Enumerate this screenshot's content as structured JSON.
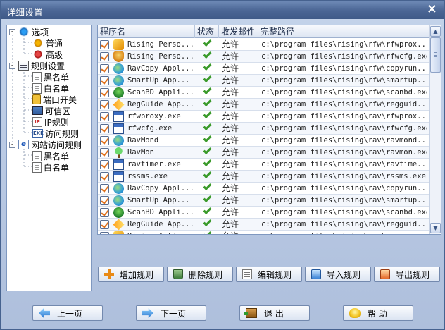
{
  "window": {
    "title": "详细设置"
  },
  "tree": [
    {
      "label": "选项",
      "icon": "gear-icon",
      "expander": "-"
    },
    {
      "label": "普通",
      "icon": "gear-small-icon"
    },
    {
      "label": "高级",
      "icon": "gear-red-icon"
    },
    {
      "label": "规则设置",
      "icon": "rules-icon",
      "expander": "-"
    },
    {
      "label": "黑名单",
      "icon": "document-icon"
    },
    {
      "label": "白名单",
      "icon": "document-icon"
    },
    {
      "label": "端口开关",
      "icon": "lock-icon"
    },
    {
      "label": "可信区",
      "icon": "computer-icon"
    },
    {
      "label": "IP规则",
      "icon": "ip-icon"
    },
    {
      "label": "访问规则",
      "icon": "exe-icon"
    },
    {
      "label": "网站访问规则",
      "icon": "web-icon",
      "expander": "-"
    },
    {
      "label": "黑名单",
      "icon": "document-icon"
    },
    {
      "label": "白名单",
      "icon": "document-icon"
    }
  ],
  "grid": {
    "columns": [
      "程序名",
      "状态",
      "收发邮件",
      "完整路径"
    ],
    "rows": [
      {
        "name": "Rising Perso...",
        "icon": "horse-icon",
        "mail": "允许",
        "path": "c:\\program files\\rising\\rfw\\rfwprox..."
      },
      {
        "name": "Rising Perso...",
        "icon": "shield-icon",
        "mail": "允许",
        "path": "c:\\program files\\rising\\rfw\\rfwcfg.exe"
      },
      {
        "name": "RavCopy Appl...",
        "icon": "globe-icon",
        "mail": "允许",
        "path": "c:\\program files\\rising\\rfw\\copyrun...."
      },
      {
        "name": "SmartUp  App...",
        "icon": "globe-icon",
        "mail": "允许",
        "path": "c:\\program files\\rising\\rfw\\smartup...."
      },
      {
        "name": "ScanBD Appli...",
        "icon": "green-shield-icon",
        "mail": "允许",
        "path": "c:\\program files\\rising\\rfw\\scanbd.exe"
      },
      {
        "name": "RegGuide App...",
        "icon": "diamond-icon",
        "mail": "允许",
        "path": "c:\\program files\\rising\\rfw\\regguid...."
      },
      {
        "name": "rfwproxy.exe",
        "icon": "window-icon",
        "mail": "允许",
        "path": "c:\\program files\\rising\\rav\\rfwprox..."
      },
      {
        "name": "rfwcfg.exe",
        "icon": "window-icon",
        "mail": "允许",
        "path": "c:\\program files\\rising\\rav\\rfwcfg.exe"
      },
      {
        "name": "RavMond",
        "icon": "globe-icon",
        "mail": "允许",
        "path": "c:\\program files\\rising\\rav\\ravmond...."
      },
      {
        "name": "RavMon",
        "icon": "tree-icon",
        "mail": "允许",
        "path": "c:\\program files\\rising\\rav\\ravmon.exe"
      },
      {
        "name": "ravtimer.exe",
        "icon": "window-icon",
        "mail": "允许",
        "path": "c:\\program files\\rising\\rav\\ravtime...."
      },
      {
        "name": "rssms.exe",
        "icon": "window-icon",
        "mail": "允许",
        "path": "c:\\program files\\rising\\rav\\rssms.exe"
      },
      {
        "name": "RavCopy Appl...",
        "icon": "globe-icon",
        "mail": "允许",
        "path": "c:\\program files\\rising\\rav\\copyrun...."
      },
      {
        "name": "SmartUp  App...",
        "icon": "globe-icon",
        "mail": "允许",
        "path": "c:\\program files\\rising\\rav\\smartup...."
      },
      {
        "name": "ScanBD Appli...",
        "icon": "green-shield-icon",
        "mail": "允许",
        "path": "c:\\program files\\rising\\rav\\scanbd.exe"
      },
      {
        "name": "RegGuide App...",
        "icon": "diamond-icon",
        "mail": "允许",
        "path": "c:\\program files\\rising\\rav\\regguid...."
      },
      {
        "name": "Rising Antiv...",
        "icon": "horse-icon",
        "mail": "允许",
        "path": "c:\\program files\\rising\\rav\\rav.exe"
      }
    ]
  },
  "actions": {
    "add": "增加规则",
    "delete": "删除规则",
    "edit": "编辑规则",
    "import": "导入规则",
    "export": "导出规则"
  },
  "nav": {
    "prev": "上一页",
    "next": "下一页",
    "exit": "退 出",
    "help": "帮 助"
  },
  "colors": {
    "title_bar": "#4a6594",
    "check": "#3a9a2a",
    "checkbox_mark": "#e0701a"
  }
}
